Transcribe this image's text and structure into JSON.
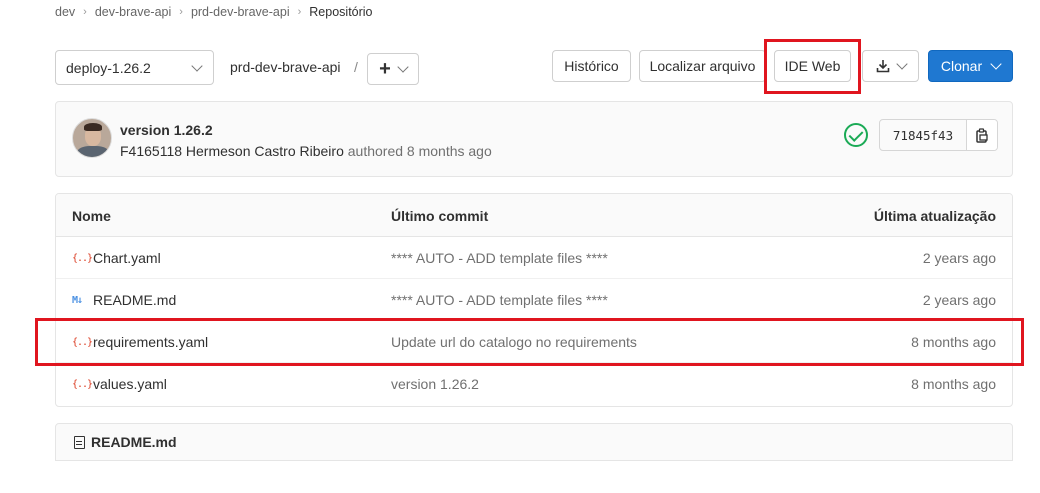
{
  "breadcrumb": [
    "dev",
    "dev-brave-api",
    "prd-dev-brave-api",
    "Repositório"
  ],
  "toolbar": {
    "branch": "deploy-1.26.2",
    "project_path": "prd-dev-brave-api",
    "path_separator": "/",
    "add_icon": "plus-icon",
    "history_label": "Histórico",
    "find_file_label": "Localizar arquivo",
    "web_ide_label": "IDE Web",
    "download_icon": "download-icon",
    "clone_label": "Clonar"
  },
  "commit": {
    "title": "version 1.26.2",
    "author": "F4165118 Hermeson Castro Ribeiro",
    "authored_text": "authored 8 months ago",
    "status": "passed",
    "sha": "71845f43",
    "copy_icon": "clipboard-icon"
  },
  "files": {
    "headers": {
      "name": "Nome",
      "last_commit": "Último commit",
      "last_update": "Última atualização"
    },
    "rows": [
      {
        "name": "Chart.yaml",
        "icon": "{..}",
        "commit": "**** AUTO - ADD template files ****",
        "updated": "2 years ago"
      },
      {
        "name": "README.md",
        "icon": "M↓",
        "commit": "**** AUTO - ADD template files ****",
        "updated": "2 years ago"
      },
      {
        "name": "requirements.yaml",
        "icon": "{..}",
        "commit": "Update url do catalogo no requirements",
        "updated": "8 months ago"
      },
      {
        "name": "values.yaml",
        "icon": "{..}",
        "commit": "version 1.26.2",
        "updated": "8 months ago"
      }
    ]
  },
  "readme": {
    "filename": "README.md"
  },
  "colors": {
    "primary": "#1f78d1",
    "success": "#1aaa55",
    "highlight": "#e0151f",
    "yaml_icon": "#db3b21"
  }
}
